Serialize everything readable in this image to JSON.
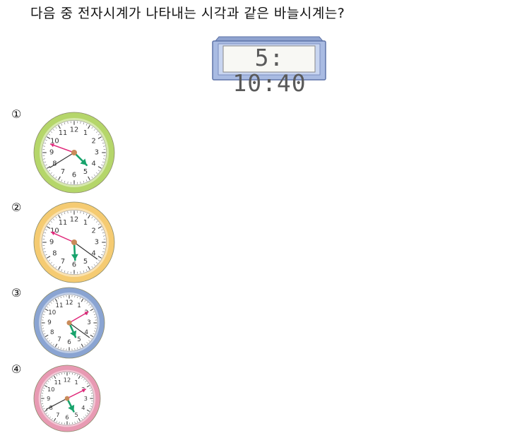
{
  "question": {
    "text": "다음 중 전자시계가 나타내는 시각과 같은 바늘시계는?"
  },
  "digital_clock": {
    "display": "5: 10:40"
  },
  "choices": [
    {
      "number": "①",
      "rim_color": "#b5d66a",
      "hands": {
        "hour": 4.5,
        "minute": 48.3,
        "second": 39.7
      }
    },
    {
      "number": "②",
      "rim_color": "#f5cb72",
      "hands": {
        "hour": 5.9,
        "minute": 49.0,
        "second": 21.0
      }
    },
    {
      "number": "③",
      "rim_color": "#8aa4d2",
      "hands": {
        "hour": 5.2,
        "minute": 10.0,
        "second": 21.0
      }
    },
    {
      "number": "④",
      "rim_color": "#e89ab3",
      "hands": {
        "hour": 5.1,
        "minute": 10.6,
        "second": 40.4
      }
    }
  ],
  "dial_numbers": [
    "12",
    "1",
    "2",
    "3",
    "4",
    "5",
    "6",
    "7",
    "8",
    "9",
    "10",
    "11"
  ],
  "colors": {
    "hour_hand": "#18a36c",
    "minute_hand": "#e0287a",
    "second_hand": "#333333",
    "center_dot": "#c98b5a"
  }
}
